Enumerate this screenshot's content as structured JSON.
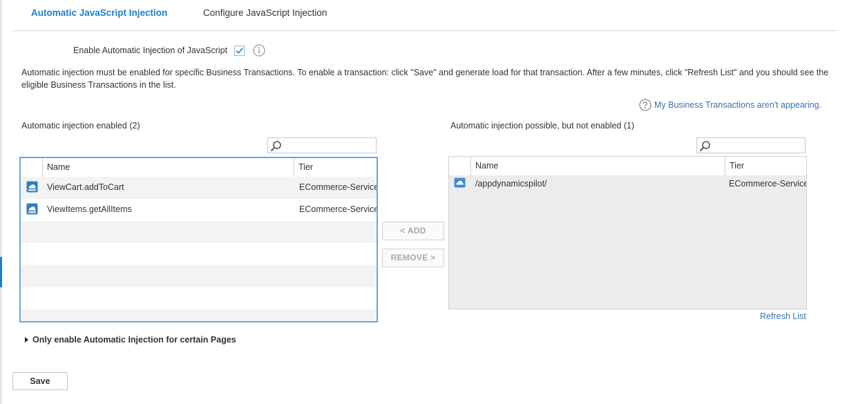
{
  "tabs": [
    {
      "label": "Automatic JavaScript Injection",
      "active": true
    },
    {
      "label": "Configure JavaScript Injection",
      "active": false
    }
  ],
  "enable": {
    "label": "Enable Automatic Injection of JavaScript",
    "checked": true
  },
  "description": "Automatic injection must be enabled for specific Business Transactions. To enable a transaction: click \"Save\" and generate load for that transaction. After a few minutes, click \"Refresh List\" and you should see the eligible Business Transactions in the list.",
  "help_link": "My Business Transactions aren't appearing.",
  "enabled_panel": {
    "title": "Automatic injection enabled (2)",
    "search_placeholder": "",
    "columns": [
      "Name",
      "Tier"
    ],
    "rows": [
      {
        "name": "ViewCart.addToCart",
        "tier": "ECommerce-Services",
        "icon": "business-transaction-icon"
      },
      {
        "name": "ViewItems.getAllItems",
        "tier": "ECommerce-Services",
        "icon": "business-transaction-icon"
      }
    ]
  },
  "possible_panel": {
    "title": "Automatic injection possible, but not enabled (1)",
    "search_placeholder": "",
    "columns": [
      "Name",
      "Tier"
    ],
    "rows": [
      {
        "name": "/appdynamicspilot/",
        "tier": "ECommerce-Services",
        "icon": "cloud-icon"
      }
    ]
  },
  "buttons": {
    "add": "< ADD",
    "remove": "REMOVE >",
    "refresh": "Refresh List",
    "save": "Save"
  },
  "pages_expander": "Only enable Automatic Injection for certain Pages",
  "colors": {
    "accent": "#1a7fd1",
    "link": "#3a6fb0",
    "grid_border_active": "#6aa6da"
  }
}
